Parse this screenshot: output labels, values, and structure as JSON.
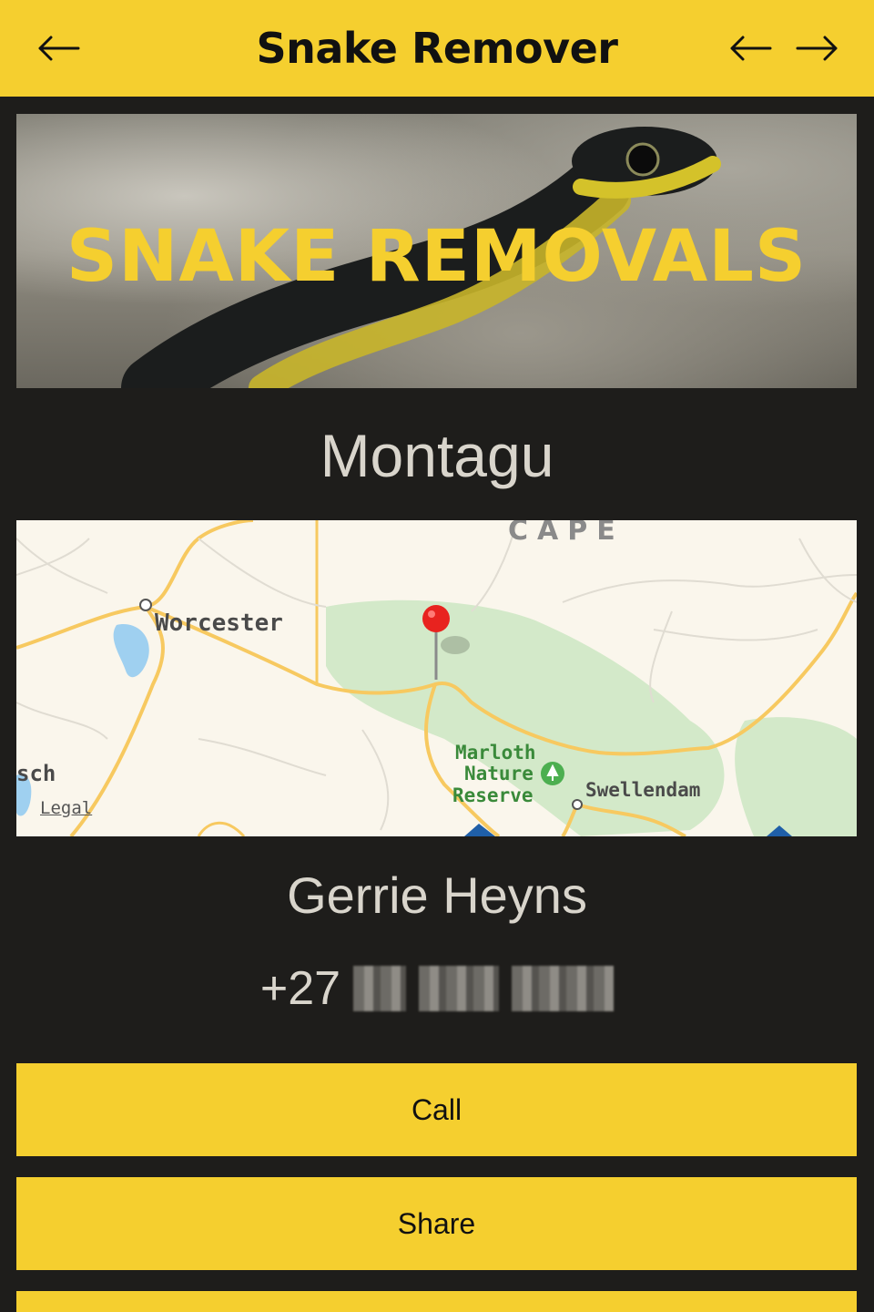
{
  "header": {
    "title": "Snake Remover",
    "back_icon": "arrow-left-icon",
    "prev_icon": "arrow-left-icon",
    "next_icon": "arrow-right-icon",
    "background": "#f5cf2f"
  },
  "banner": {
    "heading": "SNAKE REMOVALS",
    "image": "green tree snake photo"
  },
  "location": {
    "town": "Montagu"
  },
  "map": {
    "region_label": "CAPE",
    "places": [
      "Worcester",
      "Marloth",
      "Nature",
      "Reserve",
      "Swellendam",
      "sch"
    ],
    "legal": "Legal",
    "pin_color": "#e8231f",
    "park_color": "#d3e9c9",
    "road_color": "#f7c960"
  },
  "contact": {
    "name": "Gerrie Heyns",
    "phone_prefix": "+27"
  },
  "actions": {
    "call": "Call",
    "share": "Share"
  }
}
